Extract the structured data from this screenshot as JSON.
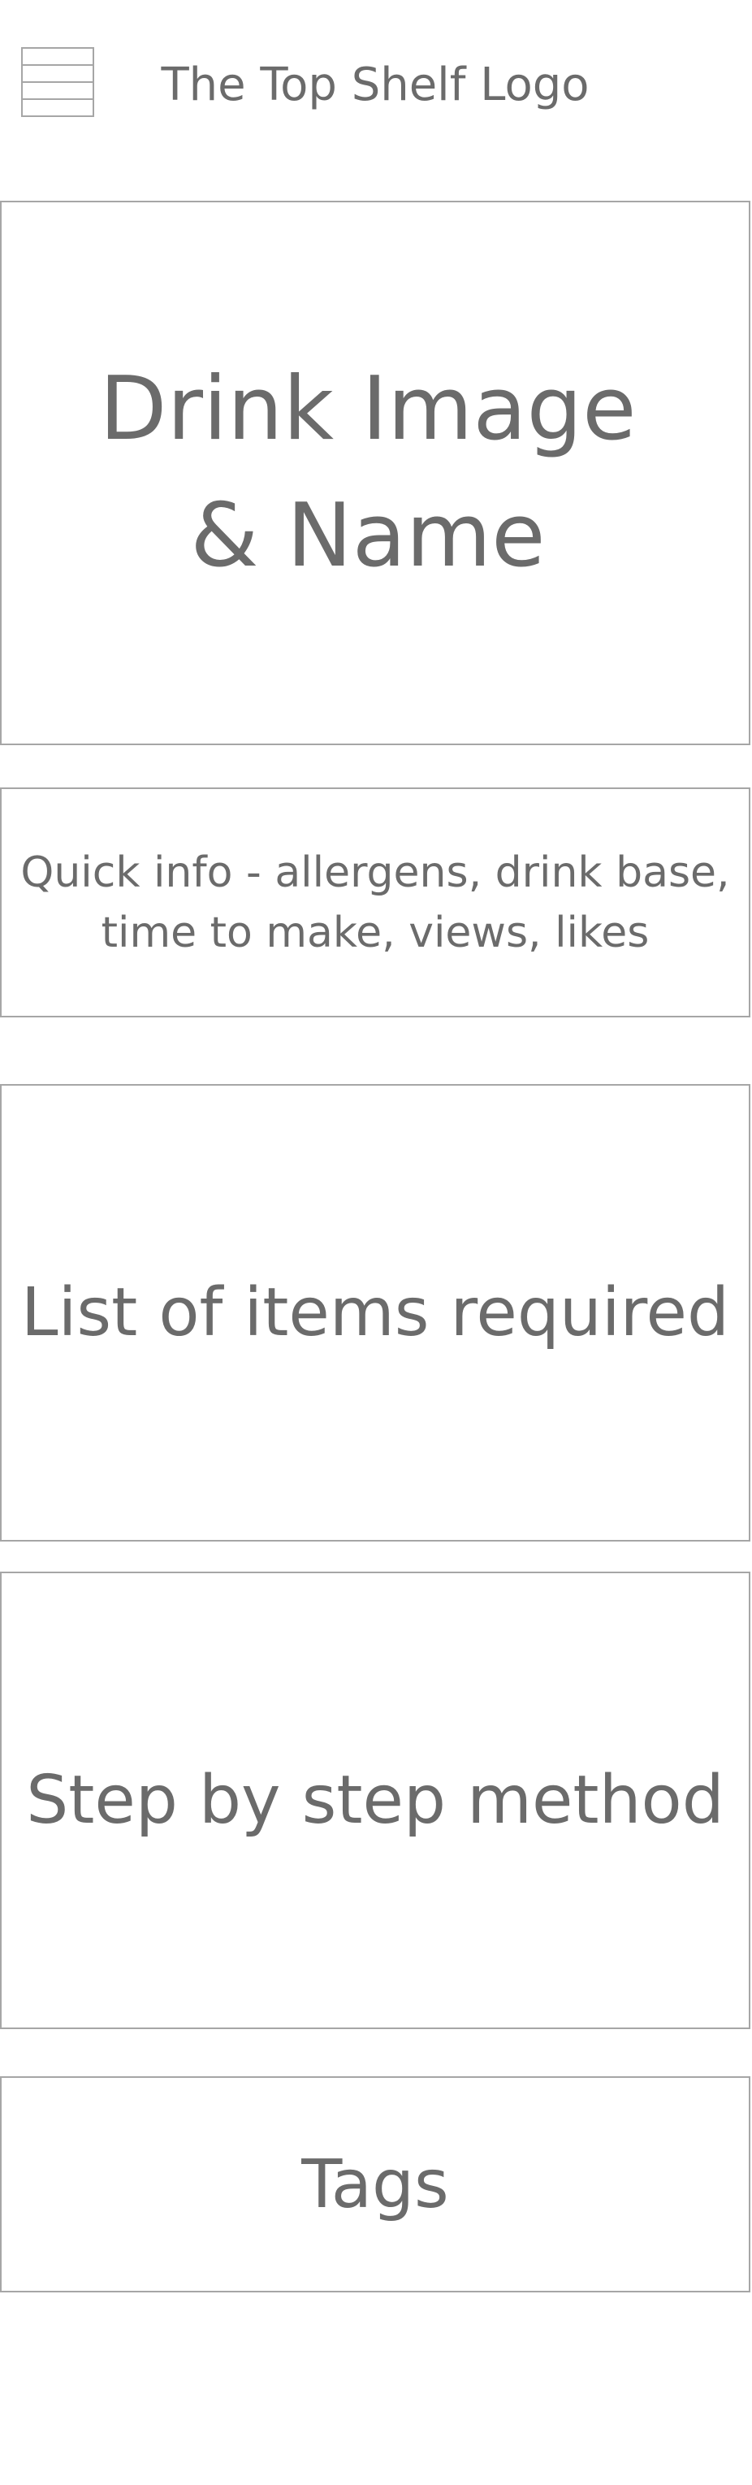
{
  "header": {
    "logo_text": "The Top Shelf Logo",
    "menu_icon": "hamburger-menu-icon"
  },
  "sections": {
    "hero_text": "Drink Image & Name",
    "quick_info_text": "Quick info - allergens, drink base, time to make, views, likes",
    "ingredients_text": "List of items required",
    "method_text": "Step by step method",
    "tags_text": "Tags"
  },
  "colors": {
    "border": "#a6a6a6",
    "text": "#6b6b6b",
    "background": "#ffffff"
  }
}
